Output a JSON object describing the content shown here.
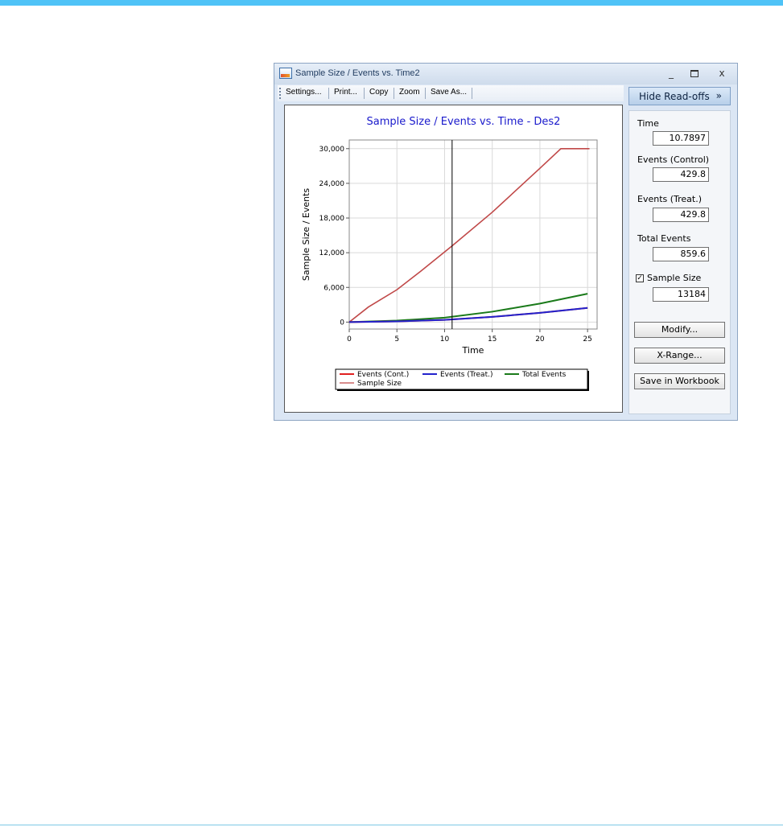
{
  "window": {
    "title": "Sample Size / Events vs. Time2",
    "minimize": "_",
    "close": "x"
  },
  "toolbar": {
    "settings": "Settings...",
    "print": "Print...",
    "copy": "Copy",
    "zoom": "Zoom",
    "save_as": "Save As..."
  },
  "readoffs": {
    "hide_button": "Hide Read-offs",
    "hide_button_chevron": "»",
    "time_label": "Time",
    "time_value": "10.7897",
    "events_control_label": "Events (Control)",
    "events_control_value": "429.8",
    "events_treat_label": "Events (Treat.)",
    "events_treat_value": "429.8",
    "total_events_label": "Total Events",
    "total_events_value": "859.6",
    "sample_size_label": "Sample Size",
    "sample_size_checked": true,
    "sample_size_value": "13184",
    "modify_button": "Modify...",
    "xrange_button": "X-Range...",
    "save_workbook_button": "Save in Workbook"
  },
  "chart_data": {
    "type": "line",
    "title": "Sample Size / Events vs. Time - Des2",
    "xlabel": "Time",
    "ylabel": "Sample Size / Events",
    "xlim": [
      0,
      26
    ],
    "ylim": [
      -1200,
      31500
    ],
    "x_ticks": [
      0,
      5,
      10,
      15,
      20,
      25
    ],
    "y_ticks": [
      0,
      6000,
      12000,
      18000,
      24000,
      30000
    ],
    "y_tick_labels": [
      "0",
      "6,000",
      "12,000",
      "18,000",
      "24,000",
      "30,000"
    ],
    "grid": true,
    "cursor_x": 10.7897,
    "legend_position": "bottom",
    "series": [
      {
        "name": "Events (Cont.)",
        "color": "#e02020",
        "x": [
          0,
          5,
          10,
          15,
          20,
          25
        ],
        "y": [
          0,
          130,
          380,
          900,
          1600,
          2450
        ]
      },
      {
        "name": "Events (Treat.)",
        "color": "#2222cc",
        "x": [
          0,
          5,
          10,
          15,
          20,
          25
        ],
        "y": [
          0,
          130,
          380,
          900,
          1600,
          2450
        ]
      },
      {
        "name": "Total Events",
        "color": "#1a7a1a",
        "x": [
          0,
          5,
          10,
          15,
          20,
          25
        ],
        "y": [
          0,
          260,
          760,
          1800,
          3200,
          4900
        ]
      },
      {
        "name": "Sample Size",
        "color": "#c04848",
        "x": [
          0,
          2,
          5,
          7.5,
          10.79,
          15,
          20,
          22.2,
          25.2
        ],
        "y": [
          0,
          2600,
          5600,
          8800,
          13184,
          19000,
          26600,
          30000,
          30000
        ]
      }
    ]
  }
}
